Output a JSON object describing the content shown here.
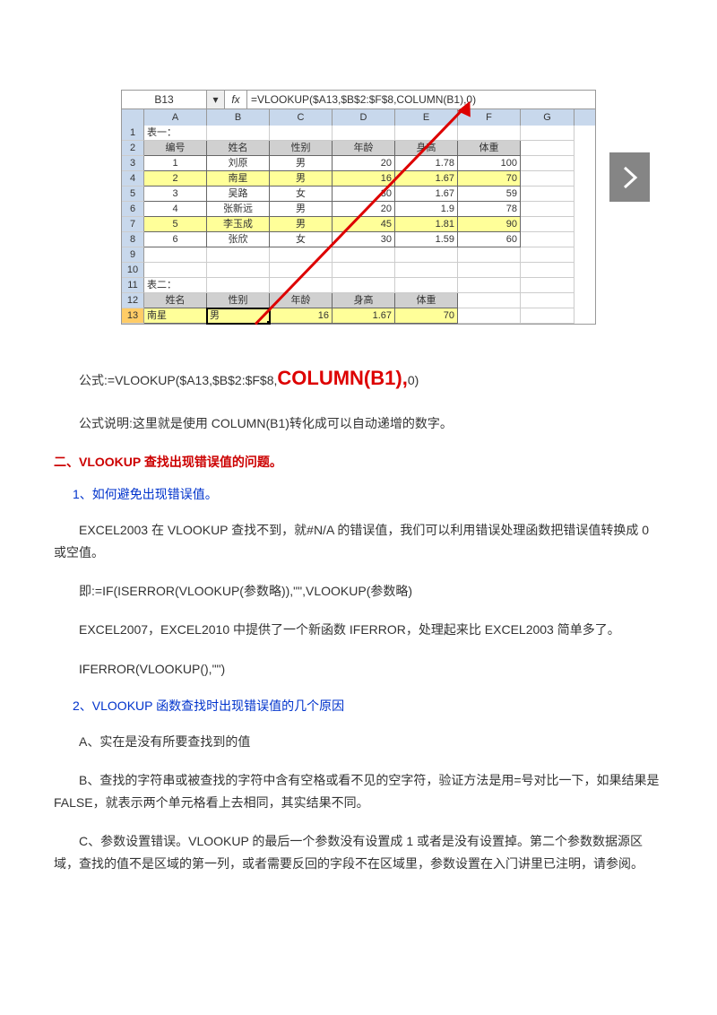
{
  "excel": {
    "name_box": "B13",
    "formula": "=VLOOKUP($A13,$B$2:$F$8,COLUMN(B1),0)",
    "cols": [
      "A",
      "B",
      "C",
      "D",
      "E",
      "F",
      "G"
    ],
    "table1_title": "表一：",
    "t1_headers": {
      "a": "编号",
      "b": "姓名",
      "c": "性别",
      "d": "年龄",
      "e": "身高",
      "f": "体重"
    },
    "rows": [
      {
        "n": "1",
        "b": "刘原",
        "c": "男",
        "d": "20",
        "e": "1.78",
        "f": "100"
      },
      {
        "n": "2",
        "b": "南星",
        "c": "男",
        "d": "16",
        "e": "1.67",
        "f": "70"
      },
      {
        "n": "3",
        "b": "吴路",
        "c": "女",
        "d": "30",
        "e": "1.67",
        "f": "59"
      },
      {
        "n": "4",
        "b": "张新远",
        "c": "男",
        "d": "20",
        "e": "1.9",
        "f": "78"
      },
      {
        "n": "5",
        "b": "李玉成",
        "c": "男",
        "d": "45",
        "e": "1.81",
        "f": "90"
      },
      {
        "n": "6",
        "b": "张欣",
        "c": "女",
        "d": "30",
        "e": "1.59",
        "f": "60"
      }
    ],
    "table2_title": "表二：",
    "t2_headers": {
      "a": "姓名",
      "b": "性别",
      "c": "年龄",
      "d": "身高",
      "e": "体重"
    },
    "t2_row": {
      "a": "南星",
      "b": "男",
      "c": "16",
      "d": "1.67",
      "e": "70"
    }
  },
  "text": {
    "formula_prefix": "公式:=VLOOKUP($A13,$B$2:$F$8,",
    "formula_mid": "COLUMN(B1),",
    "formula_suffix": "0)",
    "explain": "公式说明:这里就是使用 COLUMN(B1)转化成可以自动递增的数字。",
    "h2": "二、VLOOKUP 查找出现错误值的问题。",
    "s1": "1、如何避免出现错误值。",
    "p1": "EXCEL2003 在 VLOOKUP 查找不到，就#N/A 的错误值，我们可以利用错误处理函数把错误值转换成 0 或空值。",
    "p2": "即:=IF(ISERROR(VLOOKUP(参数略)),\"\",VLOOKUP(参数略)",
    "p3": "EXCEL2007，EXCEL2010 中提供了一个新函数 IFERROR，处理起来比 EXCEL2003 简单多了。",
    "p4": "IFERROR(VLOOKUP(),\"\")",
    "s2": "2、VLOOKUP 函数查找时出现错误值的几个原因",
    "pa": "A、实在是没有所要查找到的值",
    "pb": "B、查找的字符串或被查找的字符中含有空格或看不见的空字符，验证方法是用=号对比一下，如果结果是 FALSE，就表示两个单元格看上去相同，其实结果不同。",
    "pc": "C、参数设置错误。VLOOKUP 的最后一个参数没有设置成 1 或者是没有设置掉。第二个参数数据源区域，查找的值不是区域的第一列，或者需要反回的字段不在区域里，参数设置在入门讲里已注明，请参阅。"
  }
}
